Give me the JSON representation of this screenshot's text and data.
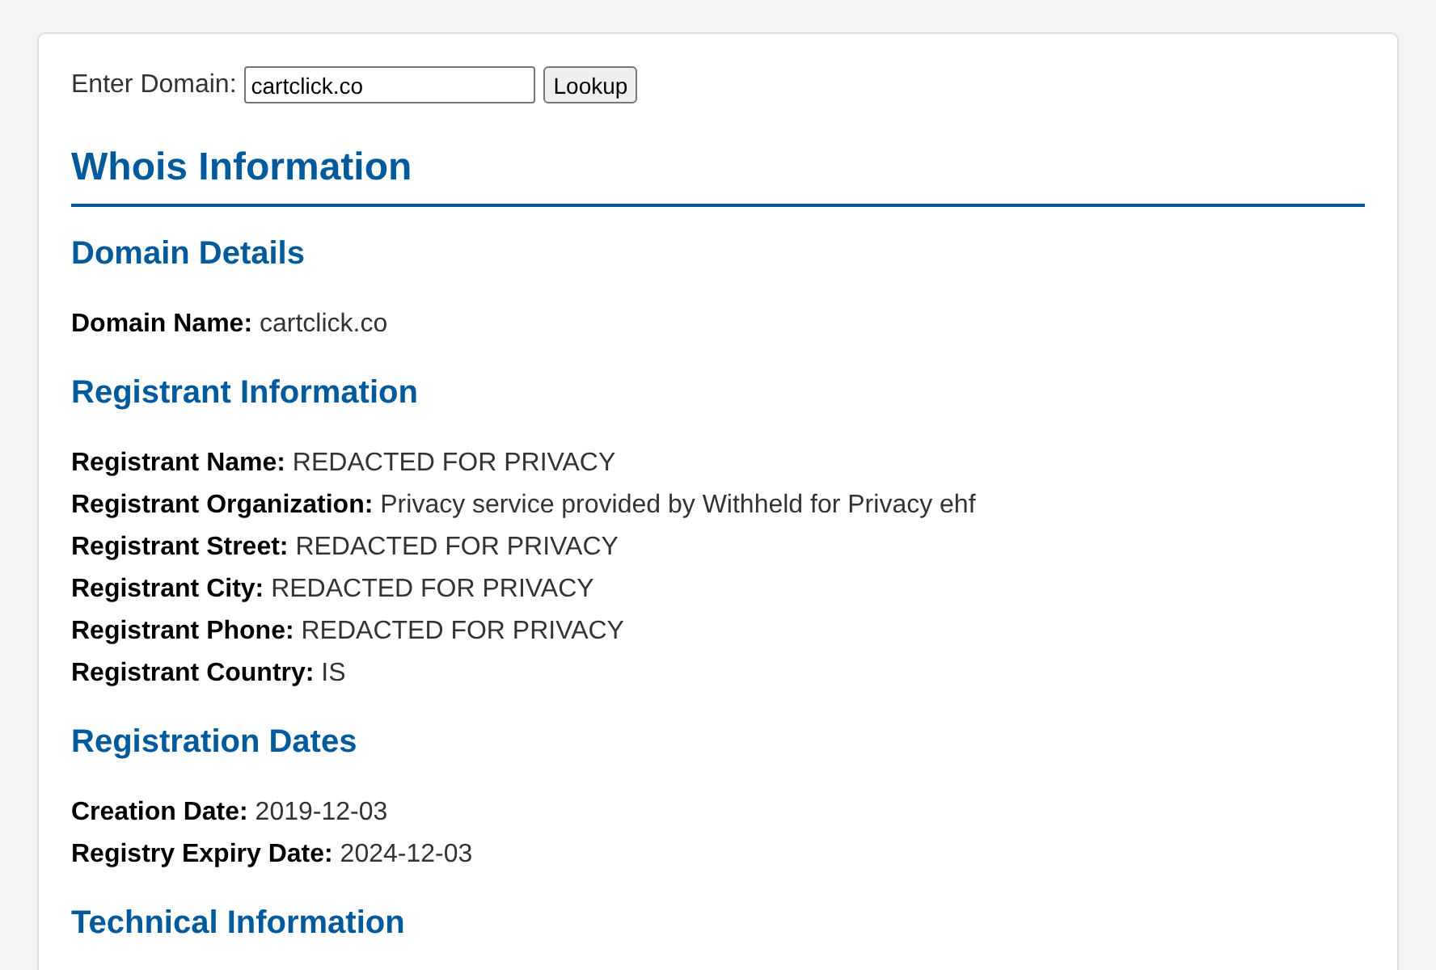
{
  "domain_form": {
    "label": "Enter Domain:",
    "value": "cartclick.co",
    "button": "Lookup"
  },
  "title": "Whois Information",
  "sections": [
    {
      "heading": "Domain Details",
      "fields": [
        {
          "label": "Domain Name:",
          "value": "cartclick.co"
        }
      ]
    },
    {
      "heading": "Registrant Information",
      "fields": [
        {
          "label": "Registrant Name:",
          "value": "REDACTED FOR PRIVACY"
        },
        {
          "label": "Registrant Organization:",
          "value": "Privacy service provided by Withheld for Privacy ehf"
        },
        {
          "label": "Registrant Street:",
          "value": "REDACTED FOR PRIVACY"
        },
        {
          "label": "Registrant City:",
          "value": "REDACTED FOR PRIVACY"
        },
        {
          "label": "Registrant Phone:",
          "value": "REDACTED FOR PRIVACY"
        },
        {
          "label": "Registrant Country:",
          "value": "IS"
        }
      ]
    },
    {
      "heading": "Registration Dates",
      "fields": [
        {
          "label": "Creation Date:",
          "value": "2019-12-03"
        },
        {
          "label": "Registry Expiry Date:",
          "value": "2024-12-03"
        }
      ]
    },
    {
      "heading": "Technical Information"
    }
  ]
}
